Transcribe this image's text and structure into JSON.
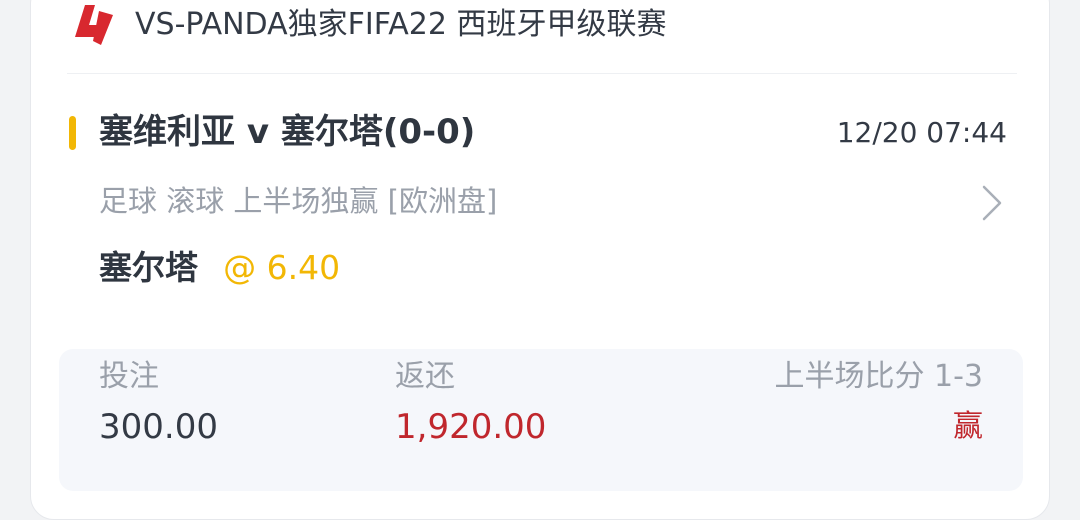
{
  "colors": {
    "accent": "#f2b705",
    "odds": "#f2b705",
    "return": "#c0272d",
    "result": "#c0272d",
    "logo": "#d8282f"
  },
  "league": {
    "logo_icon": "laliga-logo-icon",
    "title": "VS-PANDA独家FIFA22 西班牙甲级联赛"
  },
  "match": {
    "title": "塞维利亚 v 塞尔塔(0-0)",
    "time": "12/20 07:44",
    "bet_info": "足球 滚球   上半场独赢 [欧洲盘]"
  },
  "selection": {
    "name": "塞尔塔",
    "odds": "@ 6.40"
  },
  "summary": {
    "stake_label": "投注",
    "stake_value": "300.00",
    "return_label": "返还",
    "return_value": "1,920.00",
    "score_label": "上半场比分 1-3",
    "result": "赢"
  }
}
